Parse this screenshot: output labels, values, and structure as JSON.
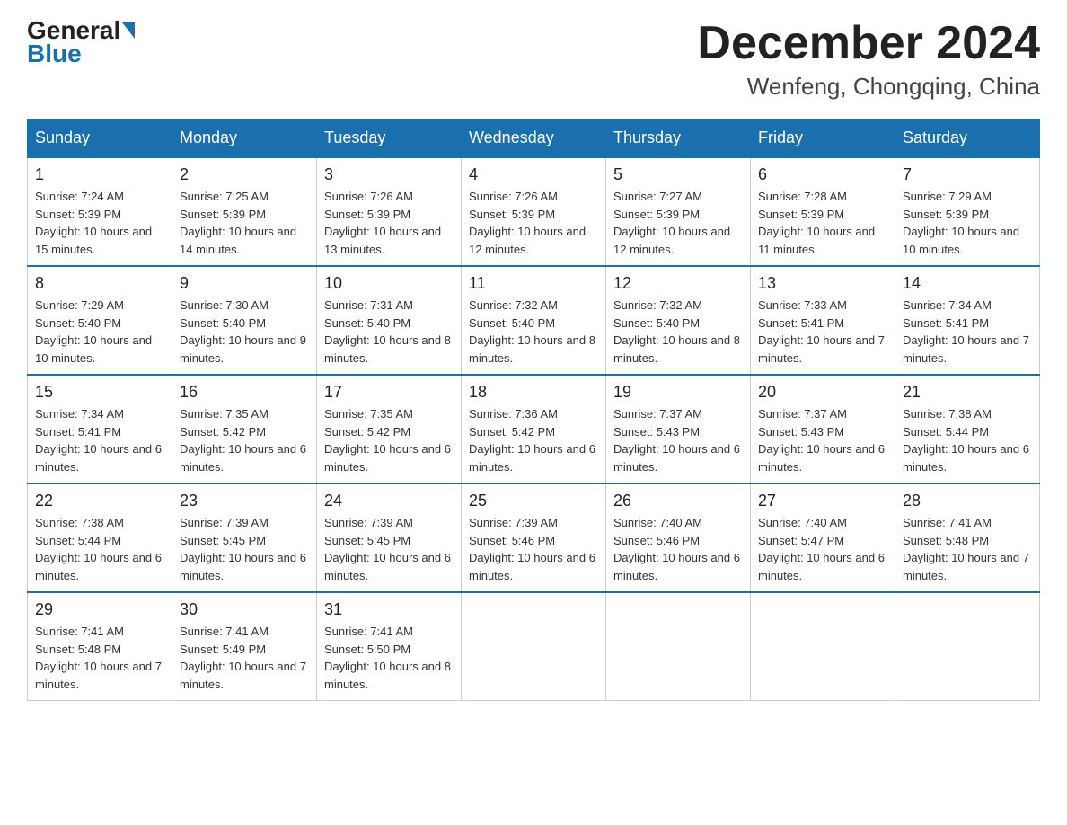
{
  "logo": {
    "general": "General",
    "blue": "Blue"
  },
  "title": "December 2024",
  "location": "Wenfeng, Chongqing, China",
  "days_of_week": [
    "Sunday",
    "Monday",
    "Tuesday",
    "Wednesday",
    "Thursday",
    "Friday",
    "Saturday"
  ],
  "weeks": [
    [
      {
        "day": "1",
        "sunrise": "7:24 AM",
        "sunset": "5:39 PM",
        "daylight": "10 hours and 15 minutes."
      },
      {
        "day": "2",
        "sunrise": "7:25 AM",
        "sunset": "5:39 PM",
        "daylight": "10 hours and 14 minutes."
      },
      {
        "day": "3",
        "sunrise": "7:26 AM",
        "sunset": "5:39 PM",
        "daylight": "10 hours and 13 minutes."
      },
      {
        "day": "4",
        "sunrise": "7:26 AM",
        "sunset": "5:39 PM",
        "daylight": "10 hours and 12 minutes."
      },
      {
        "day": "5",
        "sunrise": "7:27 AM",
        "sunset": "5:39 PM",
        "daylight": "10 hours and 12 minutes."
      },
      {
        "day": "6",
        "sunrise": "7:28 AM",
        "sunset": "5:39 PM",
        "daylight": "10 hours and 11 minutes."
      },
      {
        "day": "7",
        "sunrise": "7:29 AM",
        "sunset": "5:39 PM",
        "daylight": "10 hours and 10 minutes."
      }
    ],
    [
      {
        "day": "8",
        "sunrise": "7:29 AM",
        "sunset": "5:40 PM",
        "daylight": "10 hours and 10 minutes."
      },
      {
        "day": "9",
        "sunrise": "7:30 AM",
        "sunset": "5:40 PM",
        "daylight": "10 hours and 9 minutes."
      },
      {
        "day": "10",
        "sunrise": "7:31 AM",
        "sunset": "5:40 PM",
        "daylight": "10 hours and 8 minutes."
      },
      {
        "day": "11",
        "sunrise": "7:32 AM",
        "sunset": "5:40 PM",
        "daylight": "10 hours and 8 minutes."
      },
      {
        "day": "12",
        "sunrise": "7:32 AM",
        "sunset": "5:40 PM",
        "daylight": "10 hours and 8 minutes."
      },
      {
        "day": "13",
        "sunrise": "7:33 AM",
        "sunset": "5:41 PM",
        "daylight": "10 hours and 7 minutes."
      },
      {
        "day": "14",
        "sunrise": "7:34 AM",
        "sunset": "5:41 PM",
        "daylight": "10 hours and 7 minutes."
      }
    ],
    [
      {
        "day": "15",
        "sunrise": "7:34 AM",
        "sunset": "5:41 PM",
        "daylight": "10 hours and 6 minutes."
      },
      {
        "day": "16",
        "sunrise": "7:35 AM",
        "sunset": "5:42 PM",
        "daylight": "10 hours and 6 minutes."
      },
      {
        "day": "17",
        "sunrise": "7:35 AM",
        "sunset": "5:42 PM",
        "daylight": "10 hours and 6 minutes."
      },
      {
        "day": "18",
        "sunrise": "7:36 AM",
        "sunset": "5:42 PM",
        "daylight": "10 hours and 6 minutes."
      },
      {
        "day": "19",
        "sunrise": "7:37 AM",
        "sunset": "5:43 PM",
        "daylight": "10 hours and 6 minutes."
      },
      {
        "day": "20",
        "sunrise": "7:37 AM",
        "sunset": "5:43 PM",
        "daylight": "10 hours and 6 minutes."
      },
      {
        "day": "21",
        "sunrise": "7:38 AM",
        "sunset": "5:44 PM",
        "daylight": "10 hours and 6 minutes."
      }
    ],
    [
      {
        "day": "22",
        "sunrise": "7:38 AM",
        "sunset": "5:44 PM",
        "daylight": "10 hours and 6 minutes."
      },
      {
        "day": "23",
        "sunrise": "7:39 AM",
        "sunset": "5:45 PM",
        "daylight": "10 hours and 6 minutes."
      },
      {
        "day": "24",
        "sunrise": "7:39 AM",
        "sunset": "5:45 PM",
        "daylight": "10 hours and 6 minutes."
      },
      {
        "day": "25",
        "sunrise": "7:39 AM",
        "sunset": "5:46 PM",
        "daylight": "10 hours and 6 minutes."
      },
      {
        "day": "26",
        "sunrise": "7:40 AM",
        "sunset": "5:46 PM",
        "daylight": "10 hours and 6 minutes."
      },
      {
        "day": "27",
        "sunrise": "7:40 AM",
        "sunset": "5:47 PM",
        "daylight": "10 hours and 6 minutes."
      },
      {
        "day": "28",
        "sunrise": "7:41 AM",
        "sunset": "5:48 PM",
        "daylight": "10 hours and 7 minutes."
      }
    ],
    [
      {
        "day": "29",
        "sunrise": "7:41 AM",
        "sunset": "5:48 PM",
        "daylight": "10 hours and 7 minutes."
      },
      {
        "day": "30",
        "sunrise": "7:41 AM",
        "sunset": "5:49 PM",
        "daylight": "10 hours and 7 minutes."
      },
      {
        "day": "31",
        "sunrise": "7:41 AM",
        "sunset": "5:50 PM",
        "daylight": "10 hours and 8 minutes."
      },
      null,
      null,
      null,
      null
    ]
  ]
}
